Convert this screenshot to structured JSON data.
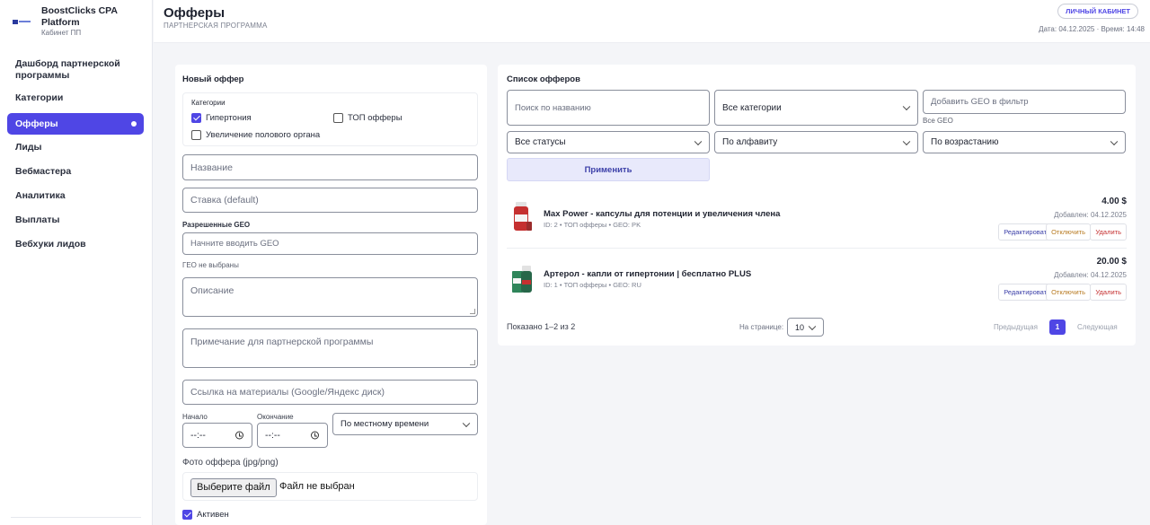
{
  "brand": {
    "title": "BoostClicks CPA Platform",
    "subtitle": "Кабинет ПП"
  },
  "sidebar": {
    "items": [
      {
        "label": "Дашборд партнерской программы"
      },
      {
        "label": "Категории"
      },
      {
        "label": "Офферы"
      },
      {
        "label": "Лиды"
      },
      {
        "label": "Вебмастера"
      },
      {
        "label": "Аналитика"
      },
      {
        "label": "Выплаты"
      },
      {
        "label": "Вебхуки лидов"
      }
    ],
    "active_index": 2
  },
  "header": {
    "title": "Офферы",
    "subtitle": "ПАРТНЕРСКАЯ ПРОГРАММА",
    "cabinet_button": "ЛИЧНЫЙ КАБИНЕТ",
    "datetime": "Дата: 04.12.2025 · Время: 14:48"
  },
  "new_offer": {
    "title": "Новый оффер",
    "categories_label": "Категории",
    "categories": [
      {
        "label": "Гипертония",
        "checked": true
      },
      {
        "label": "ТОП офферы",
        "checked": false
      },
      {
        "label": "Увеличение полового органа",
        "checked": false
      }
    ],
    "name_placeholder": "Название",
    "rate_placeholder": "Ставка (default)",
    "geo_label": "Разрешенные GEO",
    "geo_placeholder": "Начните вводить GEO",
    "geo_note": "ГЕО не выбраны",
    "description_placeholder": "Описание",
    "note_placeholder": "Примечание для партнерской программы",
    "materials_placeholder": "Ссылка на материалы (Google/Яндекс диск)",
    "start_label": "Начало",
    "end_label": "Окончание",
    "time_value": "--:--",
    "timezone_value": "По местному времени",
    "photo_label": "Фото оффера (jpg/png)",
    "file_button": "Выберите файл",
    "file_status": "Файл не выбран",
    "active_label": "Активен",
    "active_checked": true
  },
  "offer_list": {
    "title": "Список офферов",
    "search_placeholder": "Поиск по названию",
    "category_filter": "Все категории",
    "geo_filter_placeholder": "Добавить GEO в фильтр",
    "geo_filter_note": "Все GEO",
    "status_filter": "Все статусы",
    "sort_filter": "По алфавиту",
    "order_filter": "По возрастанию",
    "apply_button": "Применить",
    "offers": [
      {
        "name": "Max Power - капсулы для потенции и увеличения члена",
        "meta": "ID: 2 • ТОП офферы • GEO: PK",
        "price": "4.00 $",
        "added": "Добавлен: 04.12.2025",
        "thumb_color": "#c53030"
      },
      {
        "name": "Артерол - капли от гипертонии | бесплатно PLUS",
        "meta": "ID: 1 • ТОП офферы • GEO: RU",
        "price": "20.00 $",
        "added": "Добавлен: 04.12.2025",
        "thumb_color": "#2f855a"
      }
    ],
    "actions": {
      "edit": "Редактировать",
      "disable": "Отключить",
      "delete": "Удалить"
    },
    "shown": "Показано 1–2 из 2",
    "per_page_label": "На странице:",
    "per_page_value": "10",
    "prev": "Предыдущая",
    "current_page": "1",
    "next": "Следующая"
  },
  "colors": {
    "accent": "#4f46e5",
    "background": "#f4f5f8"
  }
}
